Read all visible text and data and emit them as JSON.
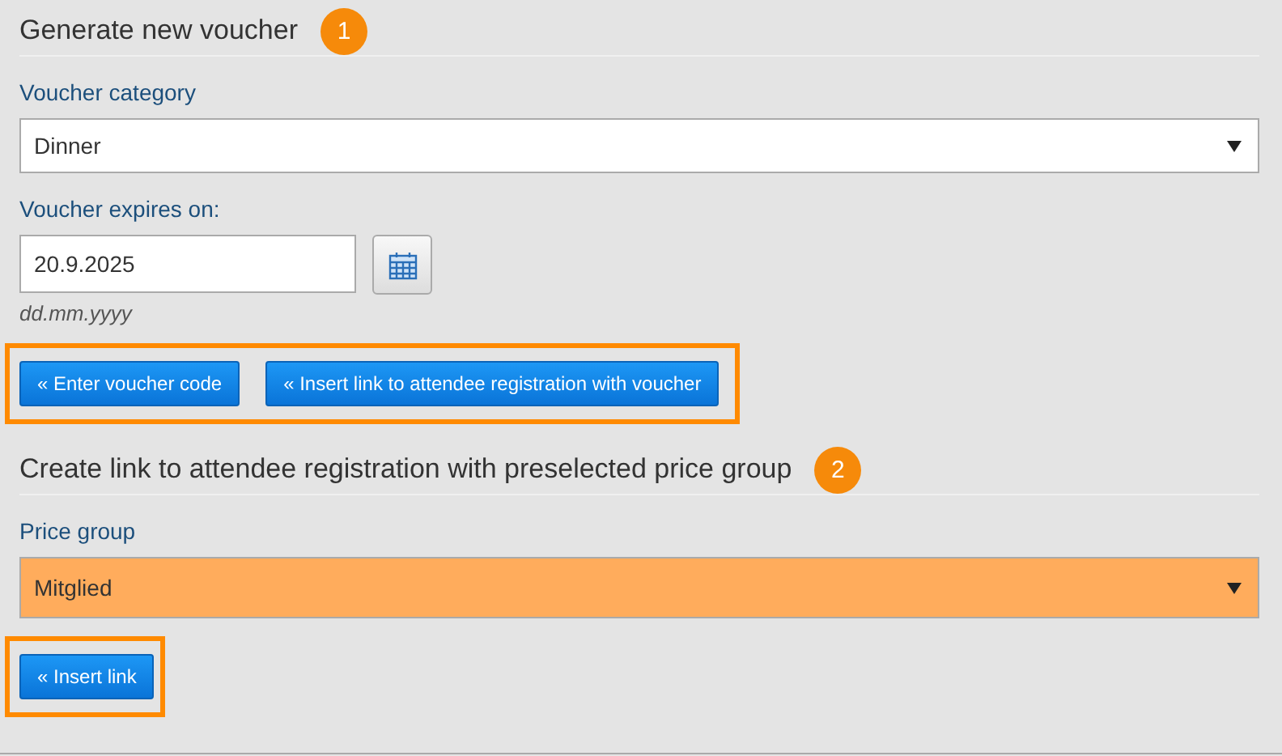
{
  "sections": [
    {
      "heading": "Generate new voucher",
      "badge": "1",
      "fields": [
        {
          "kind": "select",
          "label": "Voucher category",
          "value": "Dinner",
          "highlighted": false
        },
        {
          "kind": "date",
          "label": "Voucher expires on:",
          "value": "20.9.2025",
          "hint": "dd.mm.yyyy"
        }
      ],
      "buttons": [
        "« Enter voucher code",
        "« Insert link to attendee registration with voucher"
      ],
      "buttons_highlighted": true
    },
    {
      "heading": "Create link to attendee registration with preselected price group",
      "badge": "2",
      "fields": [
        {
          "kind": "select",
          "label": "Price group",
          "value": "Mitglied",
          "highlighted": true
        }
      ],
      "buttons": [
        "« Insert link"
      ],
      "buttons_highlighted": true
    }
  ]
}
